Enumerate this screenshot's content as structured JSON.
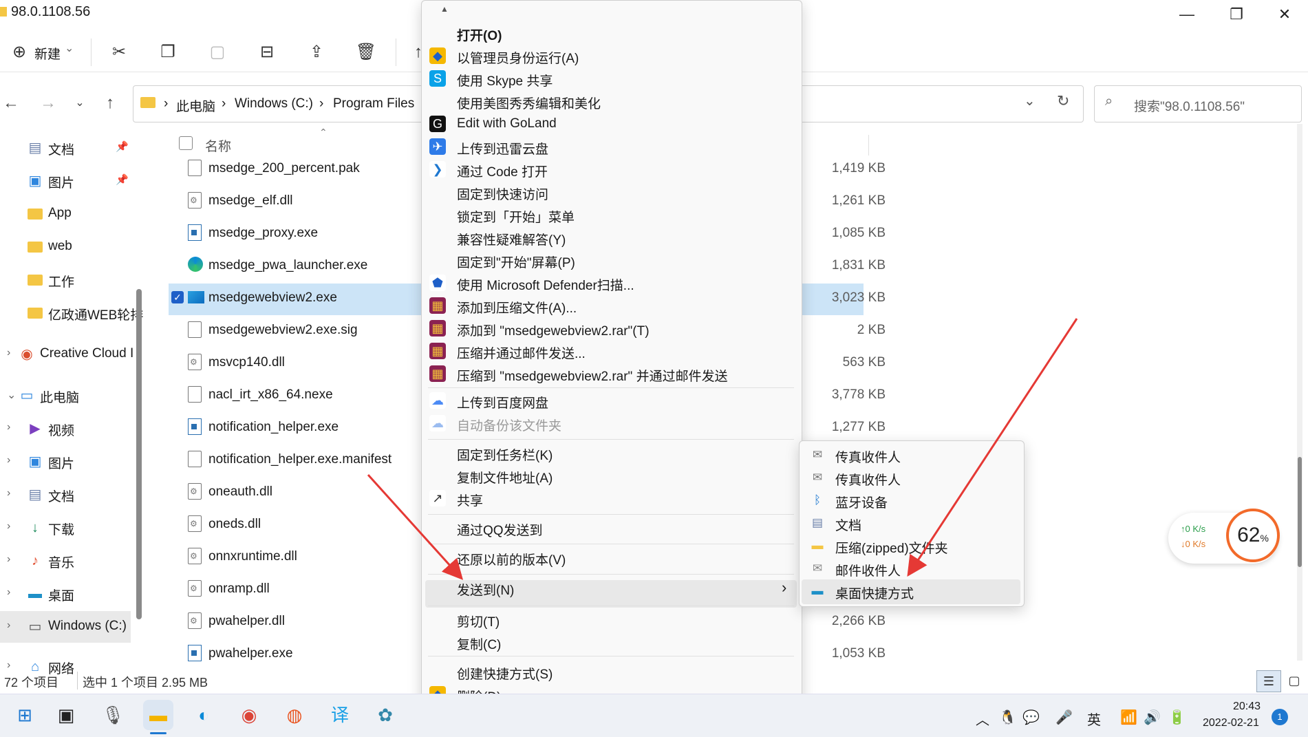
{
  "window": {
    "title": "98.0.1108.56",
    "minimize": "—",
    "maximize": "❐",
    "close": "✕"
  },
  "toolbar": {
    "new_label": "新建",
    "new_caret": "⌄"
  },
  "address": {
    "crumbs": [
      "此电脑",
      "Windows (C:)",
      "Program Files"
    ],
    "separator": "›",
    "search_placeholder": "搜索\"98.0.1108.56\""
  },
  "sidebar": {
    "items": [
      {
        "label": "文档",
        "icon": "document-icon",
        "glyph": "▤",
        "color": "#6a7fa8",
        "pinned": true
      },
      {
        "label": "图片",
        "icon": "pictures-icon",
        "glyph": "▣",
        "color": "#2e86de",
        "pinned": true
      },
      {
        "label": "App",
        "icon": "folder-icon"
      },
      {
        "label": "web",
        "icon": "folder-icon"
      },
      {
        "label": "工作",
        "icon": "folder-icon"
      },
      {
        "label": "亿政通WEB轮排",
        "icon": "folder-icon"
      },
      {
        "label": "Creative Cloud I",
        "icon": "creative-cloud-icon",
        "glyph": "◉",
        "color": "#da4f2f"
      },
      {
        "label": "此电脑",
        "icon": "computer-icon",
        "glyph": "▭",
        "color": "#2e86de"
      },
      {
        "label": "视频",
        "icon": "video-icon",
        "glyph": "▶",
        "color": "#7b3fbf"
      },
      {
        "label": "图片",
        "icon": "pictures-icon",
        "glyph": "▣",
        "color": "#2e86de"
      },
      {
        "label": "文档",
        "icon": "document-icon",
        "glyph": "▤",
        "color": "#6a7fa8"
      },
      {
        "label": "下载",
        "icon": "download-icon",
        "glyph": "↓",
        "color": "#1a8a5a"
      },
      {
        "label": "音乐",
        "icon": "music-icon",
        "glyph": "♪",
        "color": "#e2573a"
      },
      {
        "label": "桌面",
        "icon": "desktop-icon",
        "glyph": "▬",
        "color": "#1e90c8"
      },
      {
        "label": "Windows (C:)",
        "icon": "drive-icon",
        "glyph": "▭",
        "color": "#555"
      },
      {
        "label": "网络",
        "icon": "network-icon",
        "glyph": "⌂",
        "color": "#2e86de"
      }
    ]
  },
  "filelist": {
    "header_name": "名称",
    "rows": [
      {
        "name": "msedge_200_percent.pak",
        "type": "doc",
        "size": "1,419 KB"
      },
      {
        "name": "msedge_elf.dll",
        "type": "dll",
        "size": "1,261 KB"
      },
      {
        "name": "msedge_proxy.exe",
        "type": "exe",
        "size": "1,085 KB"
      },
      {
        "name": "msedge_pwa_launcher.exe",
        "type": "edge",
        "size": "1,831 KB"
      },
      {
        "name": "msedgewebview2.exe",
        "type": "webview",
        "size": "3,023 KB",
        "selected": true
      },
      {
        "name": "msedgewebview2.exe.sig",
        "type": "doc",
        "size": "2 KB"
      },
      {
        "name": "msvcp140.dll",
        "type": "dll",
        "size": "563 KB"
      },
      {
        "name": "nacl_irt_x86_64.nexe",
        "type": "doc",
        "size": "3,778 KB"
      },
      {
        "name": "notification_helper.exe",
        "type": "exe",
        "size": "1,277 KB"
      },
      {
        "name": "notification_helper.exe.manifest",
        "type": "doc",
        "size": ""
      },
      {
        "name": "oneauth.dll",
        "type": "dll",
        "size": ""
      },
      {
        "name": "oneds.dll",
        "type": "dll",
        "size": ""
      },
      {
        "name": "onnxruntime.dll",
        "type": "dll",
        "size": ""
      },
      {
        "name": "onramp.dll",
        "type": "dll",
        "size": ""
      },
      {
        "name": "pwahelper.dll",
        "type": "dll",
        "size": "2,266 KB"
      },
      {
        "name": "pwahelper.exe",
        "type": "exe",
        "size": "1,053 KB"
      }
    ]
  },
  "status": {
    "count": "72 个项目",
    "selection": "选中 1 个项目  2.95 MB"
  },
  "context_menu": {
    "scroll_up": "▲",
    "scroll_down": "▼",
    "items": [
      {
        "label": "打开(O)",
        "bold": true,
        "icon": ""
      },
      {
        "label": "以管理员身份运行(A)",
        "icon": "shield-icon",
        "glyph": "◆",
        "bg": "#f5b800",
        "fg": "#1e5fc8"
      },
      {
        "label": "使用 Skype 共享",
        "icon": "skype-icon",
        "glyph": "S",
        "bg": "#0aa2e8",
        "fg": "#fff"
      },
      {
        "label": "使用美图秀秀编辑和美化",
        "icon": ""
      },
      {
        "label": "Edit with GoLand",
        "icon": "goland-icon",
        "glyph": "G",
        "bg": "#111",
        "fg": "#fff"
      },
      {
        "label": "上传到迅雷云盘",
        "icon": "xunlei-icon",
        "glyph": "✈",
        "bg": "#2e7be8",
        "fg": "#fff"
      },
      {
        "label": "通过 Code 打开",
        "icon": "vscode-icon",
        "glyph": "❯",
        "bg": "#fff",
        "fg": "#1e78d0"
      },
      {
        "label": "固定到快速访问",
        "icon": ""
      },
      {
        "label": "锁定到「开始」菜单",
        "icon": ""
      },
      {
        "label": "兼容性疑难解答(Y)",
        "icon": ""
      },
      {
        "label": "固定到\"开始\"屏幕(P)",
        "icon": ""
      },
      {
        "label": "使用 Microsoft Defender扫描...",
        "icon": "defender-icon",
        "glyph": "⬟",
        "bg": "#fff",
        "fg": "#1e5fc8"
      },
      {
        "label": "添加到压缩文件(A)...",
        "icon": "winrar-icon",
        "glyph": "▦",
        "bg": "#8b2252",
        "fg": "#f3c03a"
      },
      {
        "label": "添加到 \"msedgewebview2.rar\"(T)",
        "icon": "winrar-icon",
        "glyph": "▦",
        "bg": "#8b2252",
        "fg": "#f3c03a"
      },
      {
        "label": "压缩并通过邮件发送...",
        "icon": "winrar-icon",
        "glyph": "▦",
        "bg": "#8b2252",
        "fg": "#f3c03a"
      },
      {
        "label": "压缩到 \"msedgewebview2.rar\" 并通过邮件发送",
        "icon": "winrar-icon",
        "glyph": "▦",
        "bg": "#8b2252",
        "fg": "#f3c03a"
      },
      {
        "label": "上传到百度网盘",
        "icon": "baidu-icon",
        "glyph": "☁",
        "bg": "#fff",
        "fg": "#4c8bf5"
      },
      {
        "label": "自动备份该文件夹",
        "icon": "baidu-icon",
        "glyph": "☁",
        "bg": "#fff",
        "fg": "#9bbcf0",
        "disabled": true
      },
      {
        "label": "固定到任务栏(K)",
        "icon": ""
      },
      {
        "label": "复制文件地址(A)",
        "icon": ""
      },
      {
        "label": "共享",
        "icon": "share-icon",
        "glyph": "↗",
        "bg": "#fff",
        "fg": "#333"
      },
      {
        "label": "通过QQ发送到",
        "icon": ""
      },
      {
        "label": "还原以前的版本(V)",
        "icon": ""
      },
      {
        "label": "发送到(N)",
        "icon": "",
        "submenu_arrow": "›"
      },
      {
        "label": "剪切(T)",
        "icon": ""
      },
      {
        "label": "复制(C)",
        "icon": ""
      },
      {
        "label": "创建快捷方式(S)",
        "icon": ""
      },
      {
        "label": "删除(D)",
        "icon": "shield-icon",
        "glyph": "◆",
        "bg": "#f5b800",
        "fg": "#1e5fc8"
      }
    ]
  },
  "send_to_menu": {
    "items": [
      {
        "label": "传真收件人",
        "icon": "fax-icon",
        "glyph": "✉",
        "fg": "#777"
      },
      {
        "label": "传真收件人",
        "icon": "fax-icon",
        "glyph": "✉",
        "fg": "#777"
      },
      {
        "label": "蓝牙设备",
        "icon": "bluetooth-icon",
        "glyph": "ᛒ",
        "fg": "#1e78d0"
      },
      {
        "label": "文档",
        "icon": "document-icon",
        "glyph": "▤",
        "fg": "#6a7fa8"
      },
      {
        "label": "压缩(zipped)文件夹",
        "icon": "zip-folder-icon",
        "glyph": "▬",
        "fg": "#f4c644"
      },
      {
        "label": "邮件收件人",
        "icon": "mail-icon",
        "glyph": "✉",
        "fg": "#888"
      },
      {
        "label": "桌面快捷方式",
        "icon": "desktop-shortcut-icon",
        "glyph": "▬",
        "fg": "#1e90c8"
      }
    ]
  },
  "net_widget": {
    "up": "↑0  K/s",
    "down": "↓0  K/s",
    "percent": "62",
    "percent_unit": "%"
  },
  "taskbar": {
    "lang": "英",
    "time": "20:43",
    "date": "2022-02-21",
    "notification_count": "1"
  }
}
